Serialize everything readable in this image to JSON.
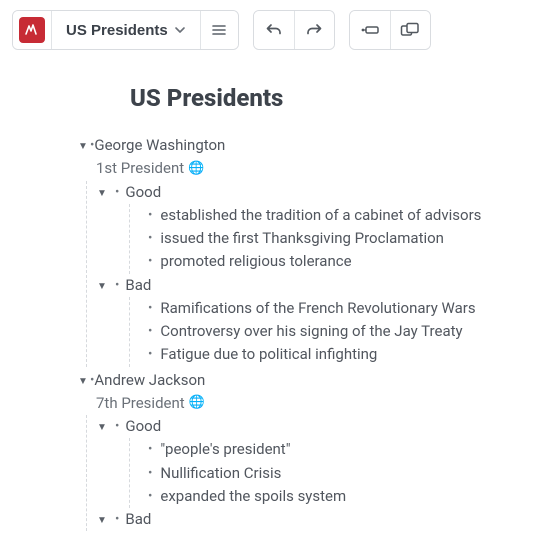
{
  "toolbar": {
    "doc_title": "US Presidents"
  },
  "page": {
    "title": "US Presidents"
  },
  "tree": [
    {
      "name": "George Washington",
      "subtitle": "1st President",
      "sections": [
        {
          "label": "Good",
          "items": [
            "established the tradition of a cabinet of advisors",
            "issued the first Thanksgiving Proclamation",
            "promoted religious tolerance"
          ]
        },
        {
          "label": "Bad",
          "items": [
            "Ramifications of the French Revolutionary Wars",
            "Controversy over his signing of the Jay Treaty",
            "Fatigue due to political infighting"
          ]
        }
      ]
    },
    {
      "name": "Andrew Jackson",
      "subtitle": "7th President",
      "sections": [
        {
          "label": "Good",
          "items": [
            "\"people's president\"",
            "Nullification Crisis",
            "expanded the spoils system"
          ]
        },
        {
          "label": "Bad",
          "items": []
        }
      ]
    }
  ]
}
